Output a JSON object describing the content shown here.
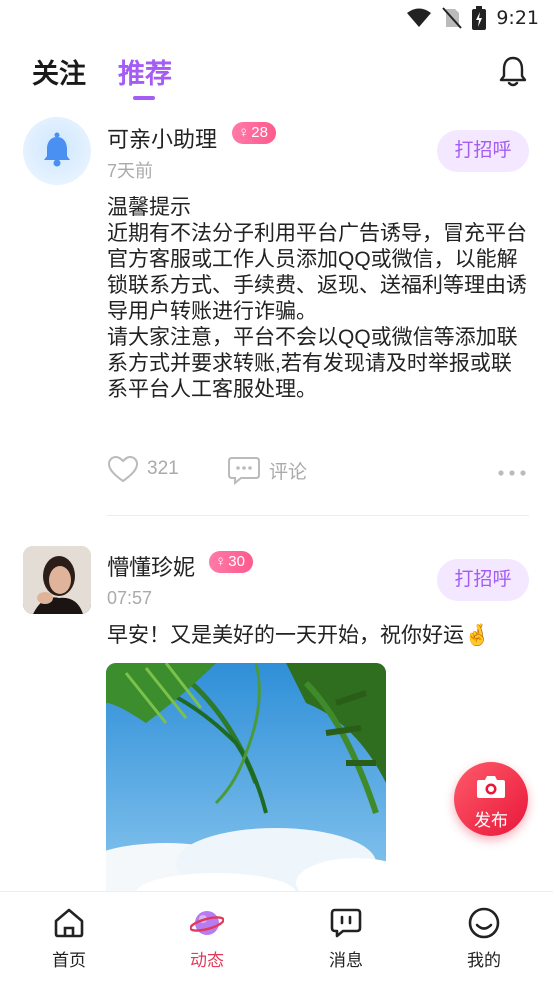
{
  "status_bar": {
    "time": "9:21"
  },
  "header": {
    "tabs": [
      {
        "label": "关注",
        "active": false
      },
      {
        "label": "推荐",
        "active": true
      }
    ]
  },
  "posts": [
    {
      "name": "可亲小助理",
      "gender_symbol": "♀",
      "age": "28",
      "time": "7天前",
      "greet_label": "打招呼",
      "content_lines": [
        "温馨提示",
        "近期有不法分子利用平台广告诱导，冒充平台官方客服或工作人员添加QQ或微信，以能解锁联系方式、手续费、返现、送福利等理由诱导用户转账进行诈骗。",
        "请大家注意，平台不会以QQ或微信等添加联系方式并要求转账,若有发现请及时举报或联系平台人工客服处理。"
      ],
      "likes": "321",
      "comment_label": "评论"
    },
    {
      "name": "懵懂珍妮",
      "gender_symbol": "♀",
      "age": "30",
      "time": "07:57",
      "greet_label": "打招呼",
      "content": "早安！又是美好的一天开始，祝你好运🤞"
    }
  ],
  "publish_label": "发布",
  "nav": [
    {
      "label": "首页",
      "icon": "home-icon",
      "active": false
    },
    {
      "label": "动态",
      "icon": "planet-icon",
      "active": true
    },
    {
      "label": "消息",
      "icon": "message-icon",
      "active": false
    },
    {
      "label": "我的",
      "icon": "profile-icon",
      "active": false
    }
  ],
  "colors": {
    "accent": "#a45cf5",
    "nav_active": "#e23b5a",
    "badge": "#ff6a9a",
    "publish": "#ee2a45"
  }
}
